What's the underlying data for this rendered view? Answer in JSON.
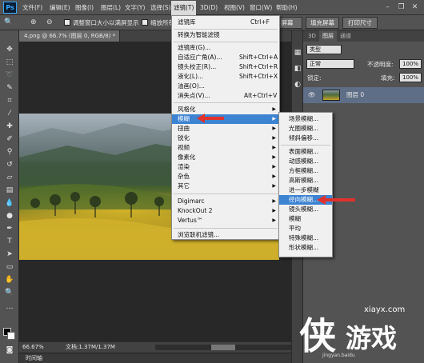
{
  "app": {
    "logo": "Ps"
  },
  "menubar": {
    "items": [
      {
        "label": "文件(F)"
      },
      {
        "label": "编辑(E)"
      },
      {
        "label": "图像(I)"
      },
      {
        "label": "图层(L)"
      },
      {
        "label": "文字(Y)"
      },
      {
        "label": "选择(S)"
      },
      {
        "label": "滤镜(T)"
      },
      {
        "label": "3D(D)"
      },
      {
        "label": "视图(V)"
      },
      {
        "label": "窗口(W)"
      },
      {
        "label": "帮助(H)"
      }
    ],
    "window_controls": {
      "minimize": "–",
      "restore": "❐",
      "close": "✕"
    }
  },
  "options_bar": {
    "resize_windows_label": "调整窗口大小以满屏显示",
    "zoom_all_label": "缩放所有",
    "fill_screen_label": "填充屏幕",
    "print_size_label": "打印尺寸",
    "screen_label": "屏幕"
  },
  "document": {
    "tab_title": "4.png @ 66.7% (图层 0, RGB/8) *",
    "tab_close": "×",
    "zoom": "66.67%",
    "doc_size": "文档:1.37M/1.37M",
    "timeline_label": "时间轴"
  },
  "layers_panel": {
    "tabs": [
      "3D",
      "图层",
      "通道"
    ],
    "kind_label": "类型",
    "blend_mode": "正常",
    "opacity_label": "不透明度:",
    "opacity_value": "100%",
    "lock_label": "锁定:",
    "fill_label": "填充:",
    "fill_value": "100%",
    "layer_name": "图层 0"
  },
  "filter_menu": {
    "items": [
      {
        "label": "滤镜库",
        "shortcut": "Ctrl+F"
      },
      {
        "label": "转换为智能滤镜",
        "shortcut": ""
      },
      {
        "label": "滤镜库(G)...",
        "shortcut": ""
      },
      {
        "label": "自适应广角(A)...",
        "shortcut": "Shift+Ctrl+A"
      },
      {
        "label": "镜头校正(R)...",
        "shortcut": "Shift+Ctrl+R"
      },
      {
        "label": "液化(L)...",
        "shortcut": "Shift+Ctrl+X"
      },
      {
        "label": "油画(O)...",
        "shortcut": ""
      },
      {
        "label": "消失点(V)...",
        "shortcut": "Alt+Ctrl+V"
      },
      {
        "label": "风格化",
        "shortcut": ""
      },
      {
        "label": "模糊",
        "shortcut": ""
      },
      {
        "label": "扭曲",
        "shortcut": ""
      },
      {
        "label": "锐化",
        "shortcut": ""
      },
      {
        "label": "视频",
        "shortcut": ""
      },
      {
        "label": "像素化",
        "shortcut": ""
      },
      {
        "label": "渲染",
        "shortcut": ""
      },
      {
        "label": "杂色",
        "shortcut": ""
      },
      {
        "label": "其它",
        "shortcut": ""
      },
      {
        "label": "Digimarc",
        "shortcut": ""
      },
      {
        "label": "KnockOut 2",
        "shortcut": ""
      },
      {
        "label": "Vertus™",
        "shortcut": ""
      },
      {
        "label": "浏览联机滤镜...",
        "shortcut": ""
      }
    ]
  },
  "blur_submenu": {
    "items": [
      {
        "label": "场景模糊..."
      },
      {
        "label": "光圈模糊..."
      },
      {
        "label": "倾斜偏移..."
      },
      {
        "label": "表面模糊..."
      },
      {
        "label": "动感模糊..."
      },
      {
        "label": "方框模糊..."
      },
      {
        "label": "高斯模糊..."
      },
      {
        "label": "进一步模糊"
      },
      {
        "label": "径向模糊..."
      },
      {
        "label": "镜头模糊..."
      },
      {
        "label": "模糊"
      },
      {
        "label": "平均"
      },
      {
        "label": "特殊模糊..."
      },
      {
        "label": "形状模糊..."
      }
    ]
  },
  "watermark": {
    "site": "xiayx.com",
    "logo_text": "侠游戏",
    "small": "jingyan.baidu"
  }
}
